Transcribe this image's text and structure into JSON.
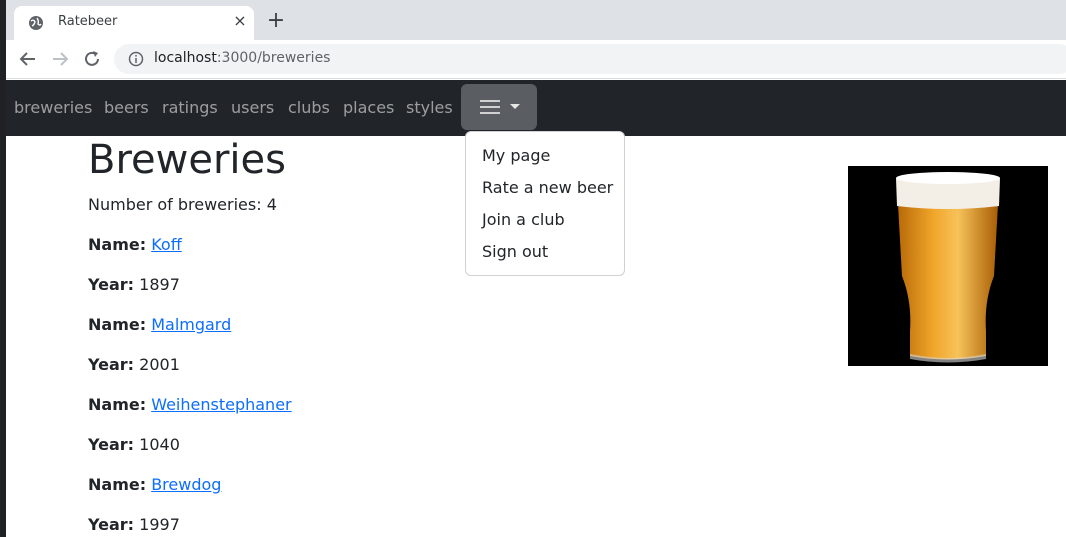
{
  "browser": {
    "tab_title": "Ratebeer",
    "tab_close": "×",
    "new_tab": "+",
    "url_host": "localhost",
    "url_path": ":3000/breweries"
  },
  "navbar": {
    "links": [
      "breweries",
      "beers",
      "ratings",
      "users",
      "clubs",
      "places",
      "styles"
    ],
    "dropdown": [
      "My page",
      "Rate a new beer",
      "Join a club",
      "Sign out"
    ]
  },
  "main": {
    "title": "Breweries",
    "count_label": "Number of breweries: 4",
    "name_label": "Name:",
    "year_label": "Year:",
    "breweries": [
      {
        "name": "Koff",
        "year": "1897"
      },
      {
        "name": "Malmgard",
        "year": "2001"
      },
      {
        "name": "Weihenstephaner",
        "year": "1040"
      },
      {
        "name": "Brewdog",
        "year": "1997"
      }
    ]
  },
  "colors": {
    "navbar_bg": "#212529",
    "link": "#0d6efd"
  },
  "icons": [
    "globe-icon",
    "close-icon",
    "plus-icon",
    "back-arrow-icon",
    "forward-arrow-icon",
    "reload-icon",
    "info-icon",
    "hamburger-icon",
    "caret-down-icon"
  ]
}
